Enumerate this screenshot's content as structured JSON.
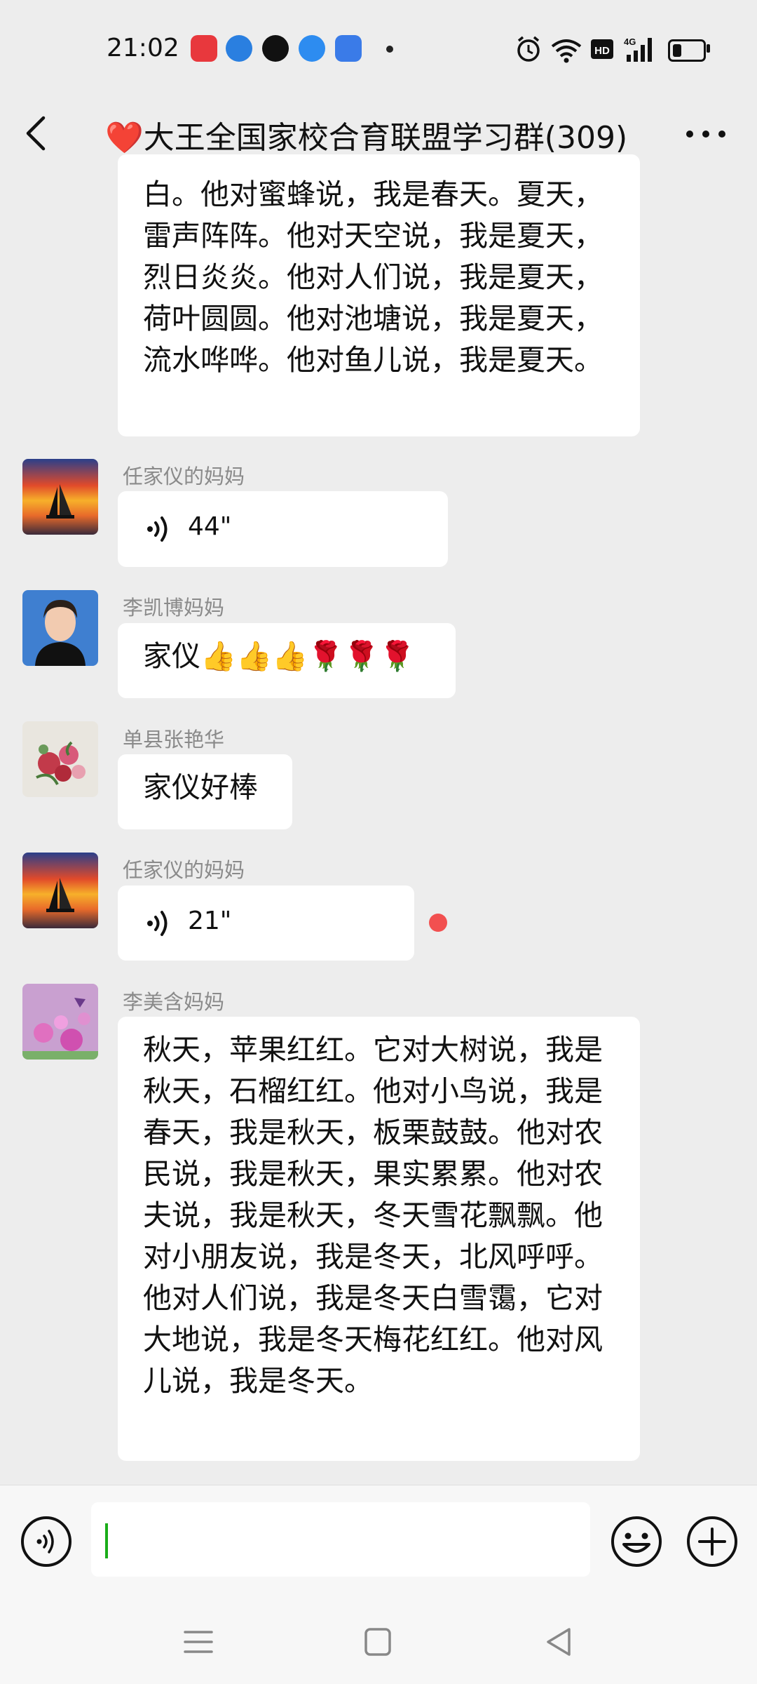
{
  "status_bar": {
    "time": "21:02",
    "battery_level": 0.3
  },
  "header": {
    "heart": "❤️",
    "title": "大王全国家校合育联盟学习群(309)"
  },
  "messages": [
    {
      "type": "text",
      "text": "白。他对蜜蜂说，我是春天。夏天，雷声阵阵。他对天空说，我是夏天，烈日炎炎。他对人们说，我是夏天，荷叶圆圆。他对池塘说，我是夏天，流水哗哗。他对鱼儿说，我是夏天。"
    },
    {
      "type": "voice",
      "sender": "任家仪的妈妈",
      "duration": "44\""
    },
    {
      "type": "text",
      "sender": "李凯博妈妈",
      "text": "家仪👍👍👍🌹🌹🌹"
    },
    {
      "type": "text",
      "sender": "单县张艳华",
      "text": "家仪好棒"
    },
    {
      "type": "voice",
      "sender": "任家仪的妈妈",
      "duration": "21\"",
      "unread": true
    },
    {
      "type": "text",
      "sender": "李美含妈妈",
      "text": "秋天，苹果红红。它对大树说，我是秋天，石榴红红。他对小鸟说，我是春天，我是秋天，板栗鼓鼓。他对农民说，我是秋天，果实累累。他对农夫说，我是秋天，冬天雪花飘飘。他对小朋友说，我是冬天，北风呼呼。他对人们说，我是冬天白雪霭，它对大地说，我是冬天梅花红红。他对风儿说，我是冬天。"
    }
  ],
  "colors": {
    "unread_dot": "#f25050",
    "caret": "#1aad19",
    "chat_bg": "#ededed"
  }
}
